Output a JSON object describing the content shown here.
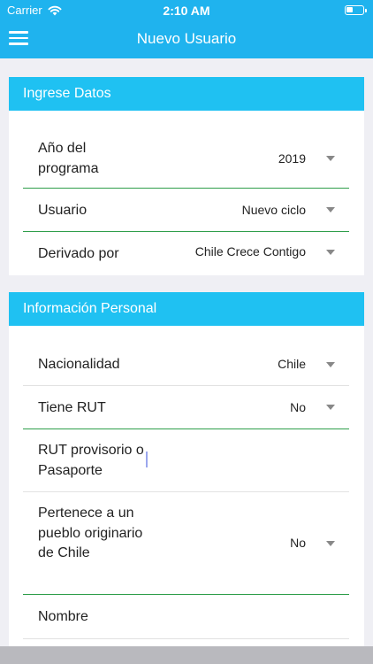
{
  "status_bar": {
    "carrier": "Carrier",
    "time": "2:10 AM"
  },
  "nav": {
    "title": "Nuevo Usuario"
  },
  "sections": {
    "ingrese": {
      "title": "Ingrese Datos",
      "fields": {
        "anio": {
          "label": "Año del programa",
          "value": "2019"
        },
        "usuario": {
          "label": "Usuario",
          "value": "Nuevo ciclo"
        },
        "derivado": {
          "label": "Derivado por",
          "value": "Chile Crece Contigo"
        }
      }
    },
    "personal": {
      "title": "Información Personal",
      "fields": {
        "nacionalidad": {
          "label": "Nacionalidad",
          "value": "Chile"
        },
        "tiene_rut": {
          "label": "Tiene RUT",
          "value": "No"
        },
        "rut_provisorio": {
          "label": "RUT provisorio o Pasaporte",
          "value": ""
        },
        "pueblo": {
          "label": "Pertenece a un pueblo originario de Chile",
          "value": "No"
        },
        "nombre": {
          "label": "Nombre",
          "value": ""
        }
      }
    }
  },
  "colors": {
    "header_blue": "#1FB3EE",
    "section_blue": "#1FC1F2",
    "divider_green": "#2F9E4B",
    "background_gray": "#EFEFF4"
  }
}
